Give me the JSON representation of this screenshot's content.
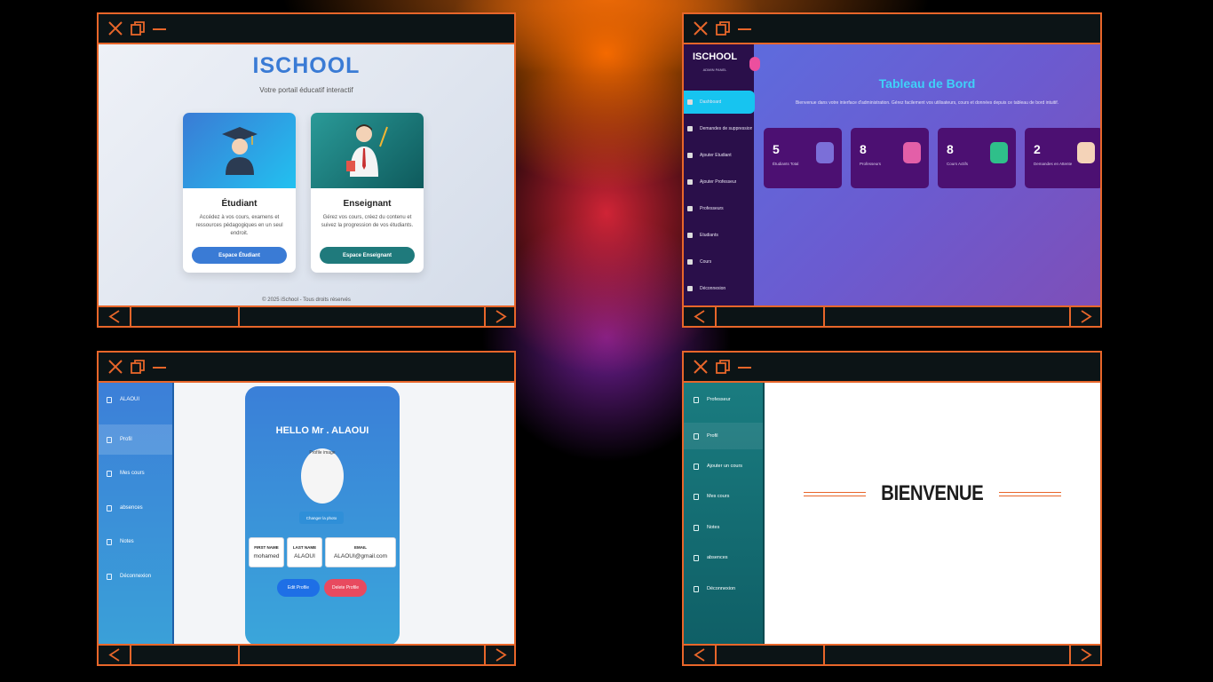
{
  "windows": {
    "home": {
      "logo": "ISCHOOL",
      "tagline": "Votre portail éducatif interactif",
      "cards": [
        {
          "title": "Étudiant",
          "description": "Accédez à vos cours, examens et ressources pédagogiques en un seul endroit.",
          "button": "Espace Étudiant"
        },
        {
          "title": "Enseignant",
          "description": "Gérez vos cours, créez du contenu et suivez la progression de vos étudiants.",
          "button": "Espace Enseignant"
        }
      ],
      "footer": "© 2025 iSchool - Tous droits réservés"
    },
    "admin": {
      "logo": "ISCHOOL",
      "subtitle": "ADMIN PANEL",
      "nav": [
        "Dashboard",
        "Demandes de suppression",
        "Ajouter Étudiant",
        "Ajouter Professeur",
        "Professeurs",
        "Étudiants",
        "Cours",
        "Déconnexion"
      ],
      "title": "Tableau de Bord",
      "description": "Bienvenue dans votre interface d'administration. Gérez facilement vos utilisateurs, cours et données depuis ce tableau de bord intuitif.",
      "stats": [
        {
          "value": "5",
          "label": "Étudiants Total"
        },
        {
          "value": "8",
          "label": "Professeurs"
        },
        {
          "value": "8",
          "label": "Cours Actifs"
        },
        {
          "value": "2",
          "label": "Demandes en Attente"
        }
      ]
    },
    "profile": {
      "nav": [
        "ALAOUI",
        "Profil",
        "Mes cours",
        "absences",
        "Notes",
        "Déconnexion"
      ],
      "hello": "HELLO Mr . ALAOUI",
      "photo_alt": "Profile image",
      "change_photo": "Changer la photo",
      "fields": [
        {
          "label": "FIRST NAME",
          "value": "mohamed"
        },
        {
          "label": "LAST NAME",
          "value": "ALAOUI"
        },
        {
          "label": "EMAIL",
          "value": "ALAOUI@gmail.com"
        }
      ],
      "edit_button": "Edit Profile",
      "delete_button": "Delete Profile"
    },
    "teacher": {
      "nav": [
        "Professeur",
        "Profil",
        "Ajouter un cours",
        "Mes cours",
        "Notes",
        "absences",
        "Déconnexion"
      ],
      "welcome": "BIENVENUE"
    }
  },
  "colors": {
    "frame": "#e8662a",
    "frame_bg": "#0c1416",
    "student_blue": "#3a7bd5",
    "teacher_teal": "#1f7a7c",
    "admin_accent": "#17c4f0"
  },
  "icons": [
    "close-icon",
    "restore-icon",
    "minimize-icon",
    "chevron-left-icon",
    "chevron-right-icon"
  ]
}
